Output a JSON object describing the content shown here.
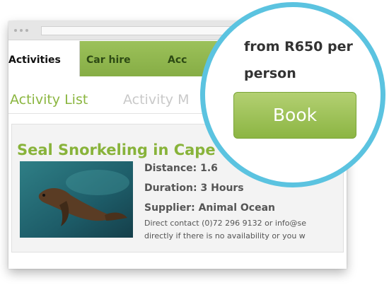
{
  "tabs": [
    {
      "label": "Activities"
    },
    {
      "label": "Car hire"
    },
    {
      "label": "Acc"
    }
  ],
  "subtabs": {
    "list": "Activity List",
    "map": "Activity M"
  },
  "activity": {
    "title": "Seal Snorkeling in Cape",
    "distance": "Distance: 1.6",
    "duration": "Duration: 3 Hours",
    "supplier": "Supplier: Animal Ocean",
    "contact_line": "Direct contact (0)72 296 9132 or info@se",
    "contact_line2": "directly if there is no availability or you w"
  },
  "magnifier": {
    "price_line1": "from R650 per",
    "price_line2": "person",
    "book_label": "Book"
  },
  "colors": {
    "accent_green": "#8bb640",
    "ring": "#5bc3e0"
  }
}
